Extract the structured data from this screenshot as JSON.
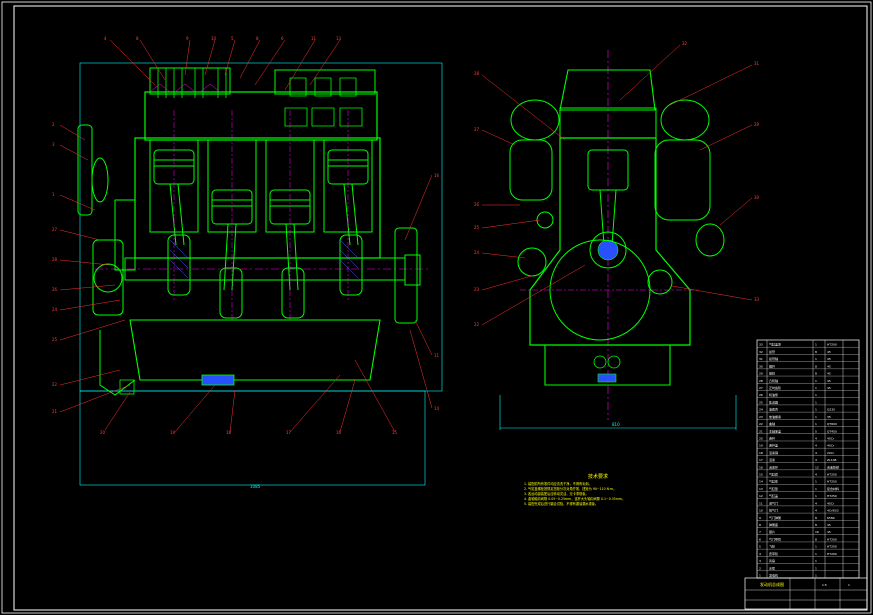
{
  "drawing": {
    "callouts_front": [
      "4",
      "8",
      "9",
      "10",
      "5",
      "8",
      "6",
      "11",
      "4",
      "13",
      "2",
      "3",
      "12",
      "17",
      "1",
      "27",
      "28",
      "26",
      "24",
      "25",
      "22",
      "21",
      "20",
      "19",
      "18",
      "17",
      "16",
      "15",
      "14",
      "11",
      "16"
    ],
    "callouts_side": [
      "32",
      "31",
      "29",
      "30",
      "28",
      "27",
      "26",
      "25",
      "24",
      "23",
      "22",
      "33",
      "32",
      "31"
    ],
    "dimensions": {
      "front_overall": "1085",
      "side_overall": "810"
    },
    "notes": {
      "title": "技术要求",
      "lines": [
        "1. 装配前所有零件均应清洗干净，不得有毛刺。",
        "2. 气缸盖螺栓按规定扭矩分次对角拧紧，扭矩为 90~110 N·m。",
        "3. 各运动副装配后应转动灵活，无卡滞现象。",
        "4. 曲轴轴向间隙 0.05~0.25mm，连杆大头轴向间隙 0.1~0.35mm。",
        "5. 装配完成后进行磨合试验，不得有漏油漏水现象。"
      ]
    },
    "title_block": {
      "name": "发动机总成图",
      "scale": "1:5",
      "sheet": "1"
    },
    "bom_rows": [
      [
        "33",
        "气缸盖罩",
        "1",
        "HT200"
      ],
      [
        "32",
        "摇臂",
        "8",
        "45"
      ],
      [
        "31",
        "摇臂轴",
        "1",
        "45"
      ],
      [
        "30",
        "推杆",
        "8",
        "45"
      ],
      [
        "29",
        "挺柱",
        "8",
        "45"
      ],
      [
        "28",
        "凸轮轴",
        "1",
        "45"
      ],
      [
        "27",
        "正时齿轮",
        "1",
        "45"
      ],
      [
        "26",
        "机油泵",
        "1",
        ""
      ],
      [
        "25",
        "集滤器",
        "1",
        ""
      ],
      [
        "24",
        "油底壳",
        "1",
        "Q235"
      ],
      [
        "23",
        "放油螺塞",
        "1",
        "35"
      ],
      [
        "22",
        "曲轴",
        "1",
        "QT600"
      ],
      [
        "21",
        "主轴承盖",
        "5",
        "QT450"
      ],
      [
        "20",
        "连杆",
        "4",
        "40Cr"
      ],
      [
        "19",
        "连杆盖",
        "4",
        "40Cr"
      ],
      [
        "18",
        "活塞销",
        "4",
        "20Cr"
      ],
      [
        "17",
        "活塞",
        "4",
        "ZL108"
      ],
      [
        "16",
        "活塞环",
        "12",
        "合金铸铁"
      ],
      [
        "15",
        "气缸套",
        "4",
        "HT250"
      ],
      [
        "14",
        "气缸体",
        "1",
        "HT250"
      ],
      [
        "13",
        "气缸垫",
        "1",
        "复合材料"
      ],
      [
        "12",
        "气缸盖",
        "1",
        "HT250"
      ],
      [
        "11",
        "进气门",
        "4",
        "40Cr"
      ],
      [
        "10",
        "排气门",
        "4",
        "4Cr9Si2"
      ],
      [
        "9",
        "气门弹簧",
        "8",
        "65Mn"
      ],
      [
        "8",
        "弹簧座",
        "8",
        "45"
      ],
      [
        "7",
        "锁片",
        "16",
        "45"
      ],
      [
        "6",
        "气门导管",
        "8",
        "HT200"
      ],
      [
        "5",
        "飞轮",
        "1",
        "HT250"
      ],
      [
        "4",
        "皮带轮",
        "1",
        "HT200"
      ],
      [
        "3",
        "风扇",
        "1",
        ""
      ],
      [
        "2",
        "水泵",
        "1",
        ""
      ],
      [
        "1",
        "发电机",
        "1",
        ""
      ]
    ],
    "colors": {
      "background": "#000000",
      "part_outline": "#00ff00",
      "leader": "#ff3030",
      "centerline": "#ff00ff",
      "frame": "#ffffff",
      "dimension": "#00ffff",
      "text": "#ffff00",
      "hatch": "#4060ff"
    }
  }
}
